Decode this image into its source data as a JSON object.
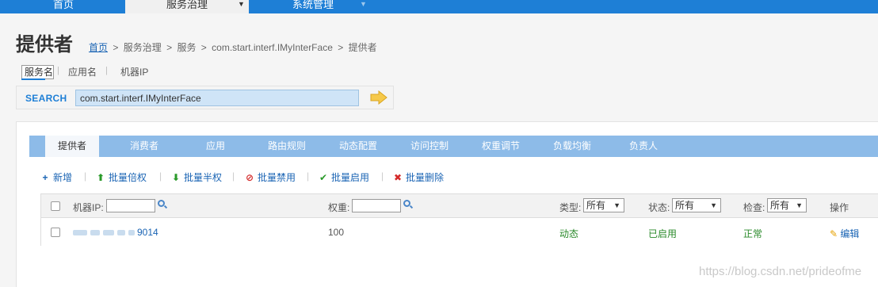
{
  "topnav": {
    "items": [
      {
        "label": "首页"
      },
      {
        "label": "服务治理",
        "caret": "▼"
      },
      {
        "label": "系统管理",
        "caret": "▼"
      }
    ]
  },
  "page": {
    "title": "提供者",
    "breadcrumb": {
      "home": "首页",
      "rest": [
        "服务治理",
        "服务",
        "com.start.interf.IMyInterFace",
        "提供者"
      ],
      "separator": ">"
    }
  },
  "search": {
    "types": [
      "服务名",
      "应用名",
      "机器IP"
    ],
    "label": "SEARCH",
    "value": "com.start.interf.IMyInterFace"
  },
  "tabs": [
    "提供者",
    "消费者",
    "应用",
    "路由规则",
    "动态配置",
    "访问控制",
    "权重调节",
    "负载均衡",
    "负责人"
  ],
  "toolbar": {
    "add": "新增",
    "double": "批量倍权",
    "half": "批量半权",
    "disable": "批量禁用",
    "enable": "批量启用",
    "delete": "批量删除"
  },
  "table": {
    "header": {
      "ip_label": "机器IP:",
      "weight_label": "权重:",
      "type_label": "类型:",
      "type_value": "所有",
      "status_label": "状态:",
      "status_value": "所有",
      "check_label": "检查:",
      "check_value": "所有",
      "ops_label": "操作"
    },
    "rows": [
      {
        "ip_suffix": "9014",
        "weight": "100",
        "type": "动态",
        "status": "已启用",
        "check": "正常",
        "op": "编辑"
      }
    ]
  },
  "watermark": "https://blog.csdn.net/prideofme",
  "colors": {
    "nav_blue": "#1e7fd6",
    "tab_blue": "#8dbbe8",
    "link_blue": "#1a64b4",
    "ok_green": "#2a8a2a"
  }
}
